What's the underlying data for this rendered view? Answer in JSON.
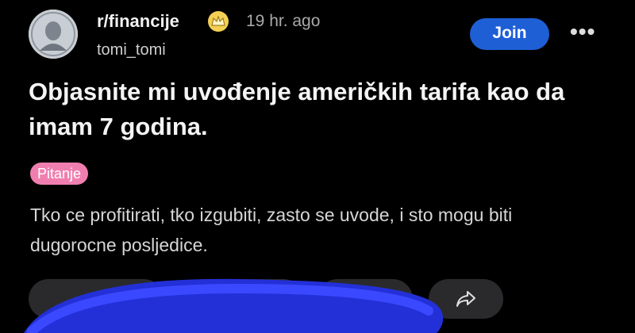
{
  "post": {
    "subreddit": "r/financije",
    "time": "19 hr. ago",
    "username": "tomi_tomi",
    "join_label": "Join",
    "more_label": "•••",
    "title": "Objasnite mi uvođenje američkih tarifa kao da imam 7 godina.",
    "flair": "Pitanje",
    "body": "Tko ce profitirati, tko izgubiti, zasto se uvode, i sto mogu biti dugorocne posljedice."
  },
  "colors": {
    "background": "#000000",
    "join_button": "#1e5fd6",
    "flair": "#f07fb0",
    "badge": "#f3cf54",
    "scribble": "#2330d8"
  },
  "icons": {
    "avatar": "banknote-portrait-avatar",
    "badge": "crown-badge-icon",
    "share": "share-icon"
  }
}
